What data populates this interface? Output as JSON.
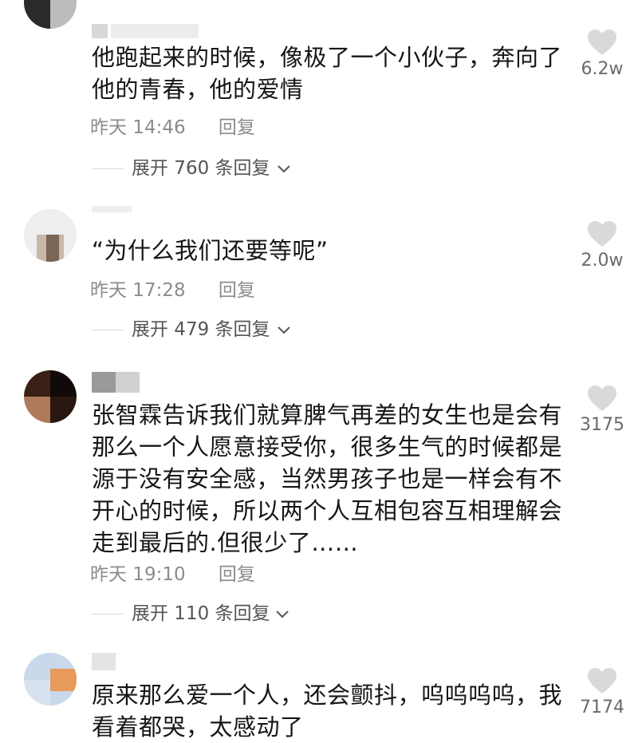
{
  "comments": [
    {
      "text": "他跑起来的时候，像极了一个小伙子，奔向了\n他的青春，他的爱情",
      "time": "昨天 14:46",
      "reply_label": "回复",
      "expand_label": "展开 760 条回复",
      "likes": "6.2w",
      "avatar_colors": [
        "#cfcfcf",
        "#2a2a2a",
        "#9a9a9a"
      ]
    },
    {
      "text": "“为什么我们还要等呢”",
      "time": "昨天 17:28",
      "reply_label": "回复",
      "expand_label": "展开 479 条回复",
      "likes": "2.0w",
      "avatar_colors": [
        "#e6e6e6",
        "#c8b8a8",
        "#7a6658"
      ]
    },
    {
      "text": "张智霖告诉我们就算脾气再差的女生也是会有\n那么一个人愿意接受你，很多生气的时候都是\n源于没有安全感，当然男孩子也是一样会有不\n开心的时候，所以两个人互相包容互相理解会\n走到最后的.但很少了……",
      "time": "昨天 19:10",
      "reply_label": "回复",
      "expand_label": "展开 110 条回复",
      "likes": "3175",
      "avatar_colors": [
        "#3a2014",
        "#120a08",
        "#b07a5a"
      ]
    },
    {
      "text": "原来那么爱一个人，还会颤抖，呜呜呜呜，我\n看着都哭，太感动了",
      "time": "",
      "reply_label": "",
      "expand_label": "",
      "likes": "7174",
      "avatar_colors": [
        "#c9d8ea",
        "#e89a5a",
        "#7a90b0"
      ]
    }
  ],
  "colors": {
    "text": "#161616",
    "meta": "#8c8c8c",
    "heart": "#d9d9d9",
    "divider": "#d9d9d9"
  }
}
